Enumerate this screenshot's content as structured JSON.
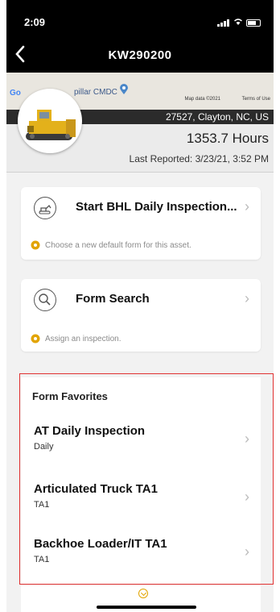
{
  "status": {
    "time": "2:09"
  },
  "nav": {
    "title": "KW290200"
  },
  "map": {
    "google_logo": "Go",
    "location_label": "pillar CMDC",
    "map_data": "Map data ©2021",
    "terms": "Terms of Use"
  },
  "asset": {
    "location": "27527, Clayton, NC, US",
    "hours": "1353.7 Hours",
    "last_reported": "Last Reported: 3/23/21, 3:52 PM"
  },
  "cards": {
    "inspection": {
      "title": "Start BHL Daily Inspection...",
      "hint": "Choose a new default form for this asset."
    },
    "search": {
      "title": "Form Search",
      "hint": "Assign an inspection."
    }
  },
  "favorites": {
    "header": "Form Favorites",
    "items": [
      {
        "title": "AT Daily Inspection",
        "subtitle": "Daily"
      },
      {
        "title": "Articulated Truck TA1",
        "subtitle": "TA1"
      },
      {
        "title": "Backhoe Loader/IT TA1",
        "subtitle": "TA1"
      }
    ]
  },
  "colors": {
    "accent": "#e2a400",
    "highlight_border": "#e03131"
  },
  "icons": {
    "back": "chevron-left-icon",
    "inspection": "excavator-icon",
    "search": "magnifier-icon",
    "hint": "gear-icon",
    "expand": "chevron-down-icon"
  }
}
